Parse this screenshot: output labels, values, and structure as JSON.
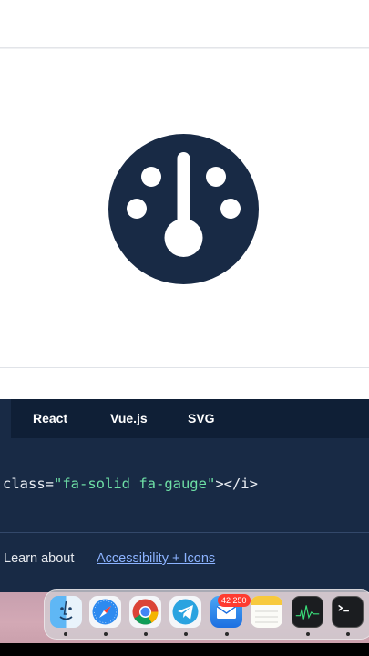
{
  "icon_preview": {
    "icon": "gauge-icon",
    "icon_color": "#182a45"
  },
  "code_panel": {
    "tabs": [
      {
        "label": "React"
      },
      {
        "label": "Vue.js"
      },
      {
        "label": "SVG"
      }
    ],
    "snippet": {
      "attr": "class=",
      "value": "\"fa-solid fa-gauge\"",
      "close": "></i>"
    },
    "footer": {
      "text": "Learn about",
      "link": "Accessibility + Icons"
    },
    "colors": {
      "background": "#182a45",
      "tab_bar": "#0f1f36",
      "string": "#6ee0a6",
      "link": "#8cb3ff"
    }
  },
  "dock": {
    "apps": [
      {
        "name": "finder",
        "icon": "finder-icon"
      },
      {
        "name": "safari",
        "icon": "safari-icon"
      },
      {
        "name": "chrome",
        "icon": "chrome-icon"
      },
      {
        "name": "telegram",
        "icon": "telegram-icon"
      },
      {
        "name": "mail",
        "icon": "mail-icon",
        "badge": "42 250"
      },
      {
        "name": "notes",
        "icon": "notes-icon"
      },
      {
        "name": "activity-monitor",
        "icon": "activity-monitor-icon"
      },
      {
        "name": "terminal",
        "icon": "terminal-icon"
      }
    ]
  }
}
